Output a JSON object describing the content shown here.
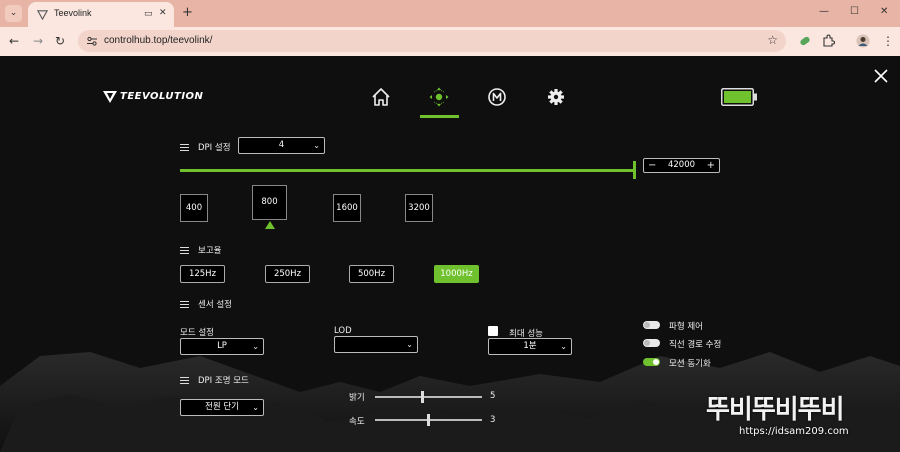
{
  "browser": {
    "tab_title": "Teevolink",
    "url": "controlhub.top/teevolink/",
    "tab_menu_icon": "chevron-down-icon",
    "media_icon": "media-icon",
    "close_tab_icon": "close-icon",
    "new_tab_label": "+",
    "window_controls": [
      "minimize-icon",
      "maximize-icon",
      "close-icon"
    ]
  },
  "app": {
    "logo_text": "TEEVOLUTION",
    "nav": [
      "home-icon",
      "dpi-icon",
      "macro-icon",
      "settings-icon"
    ],
    "active_nav": "dpi-icon",
    "accent_color": "#6fc22d",
    "battery_level": 1.0
  },
  "dpi_settings": {
    "label": "DPI 설정",
    "selected_stage": "4",
    "max_dpi": "42000",
    "slider_level": 1.0,
    "presets": [
      "400",
      "800",
      "1600",
      "3200"
    ],
    "selected_preset": "800"
  },
  "report_rate": {
    "label": "보고율",
    "options": [
      "125Hz",
      "250Hz",
      "500Hz",
      "1000Hz"
    ],
    "selected": "1000Hz"
  },
  "sensor": {
    "label": "센서 설정",
    "mode_label": "모드 설정",
    "mode_value": "LP",
    "lod_label": "LOD",
    "lod_value": "",
    "max_perf_label": "최대 성능",
    "max_perf_value": "1분",
    "toggles": [
      {
        "label": "파형 제어",
        "on": false
      },
      {
        "label": "직선 경로 수정",
        "on": false
      },
      {
        "label": "모션 동기화",
        "on": true
      }
    ]
  },
  "dpi_light": {
    "label": "DPI 조명 모드",
    "mode_value": "전원 단기",
    "brightness_label": "밝기",
    "brightness_value": "5",
    "speed_label": "속도",
    "speed_value": "3"
  },
  "watermark": {
    "title": "뚜비뚜비뚜비",
    "url": "https://idsam209.com"
  }
}
